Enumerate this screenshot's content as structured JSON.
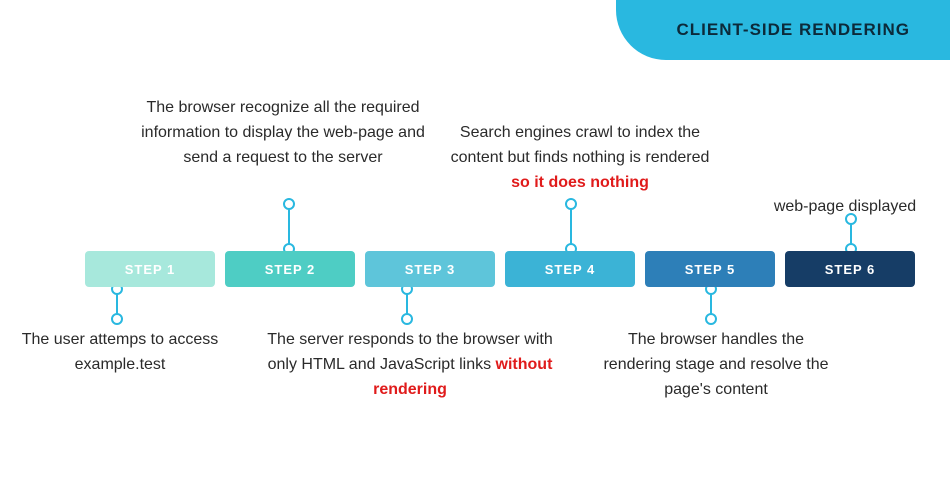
{
  "banner": {
    "title": "CLIENT-SIDE RENDERING"
  },
  "steps": [
    {
      "label": "STEP 1",
      "color": "#a7e8dc"
    },
    {
      "label": "STEP 2",
      "color": "#4ecdc4"
    },
    {
      "label": "STEP 3",
      "color": "#5ec5da"
    },
    {
      "label": "STEP 4",
      "color": "#3bb3d6"
    },
    {
      "label": "STEP 5",
      "color": "#2d7fb8"
    },
    {
      "label": "STEP 6",
      "color": "#163d66"
    }
  ],
  "captions": {
    "c1": {
      "text": "The user attemps to access example.test"
    },
    "c2": {
      "text": "The browser recognize all the required information to display the web-page and send a request to the server"
    },
    "c3": {
      "prefix": "The server responds to the browser with only HTML and JavaScript links ",
      "em": "without rendering"
    },
    "c4": {
      "prefix": "Search engines crawl to index the content but finds nothing is rendered ",
      "em": "so it does nothing"
    },
    "c5": {
      "text": "The browser handles the rendering stage and resolve the page's content"
    },
    "c6": {
      "text": "web-page displayed"
    }
  }
}
